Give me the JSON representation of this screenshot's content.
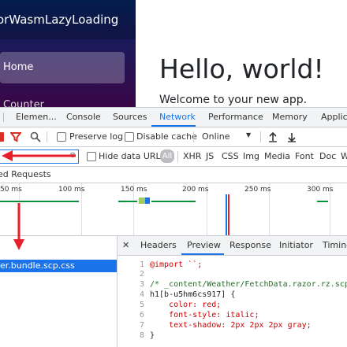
{
  "app": {
    "brand": "orWasmLazyLoading",
    "nav": {
      "home": "Home",
      "counter": "Counter"
    },
    "heading": "Hello, world!",
    "welcome": "Welcome to your new app."
  },
  "devtools": {
    "tabs": [
      "Elemen...",
      "Console",
      "Sources",
      "Network",
      "Performance",
      "Memory",
      "Applica"
    ],
    "active_tab": "Network",
    "toolbar": {
      "preserve_log": "Preserve log",
      "disable_cache": "Disable cache",
      "throttle": "Online"
    },
    "filter": {
      "hide_data_urls": "Hide data URLs",
      "types": [
        "All",
        "XHR",
        "JS",
        "CSS",
        "Img",
        "Media",
        "Font",
        "Doc",
        "W"
      ],
      "active_type": "All"
    },
    "blocked_requests": "ed Requests",
    "timeline_ticks": [
      "50 ms",
      "100 ms",
      "150 ms",
      "200 ms",
      "250 ms",
      "300 ms"
    ],
    "selected_request": "er.bundle.scp.css",
    "detail_tabs": [
      "Headers",
      "Preview",
      "Response",
      "Initiator",
      "Timing"
    ],
    "active_detail_tab": "Preview",
    "code_lines": [
      {
        "n": "1",
        "t": "@import ``;"
      },
      {
        "n": "2",
        "t": ""
      },
      {
        "n": "3",
        "t": "/* _content/Weather/FetchData.razor.rz.scp"
      },
      {
        "n": "4",
        "t": "h1[b-u5hm6cs917] {"
      },
      {
        "n": "5",
        "t": "    color: red;"
      },
      {
        "n": "6",
        "t": "    font-style: italic;"
      },
      {
        "n": "7",
        "t": "    text-shadow: 2px 2px 2px gray;"
      },
      {
        "n": "8",
        "t": "}"
      }
    ]
  },
  "colors": {
    "accent": "#1a73e8",
    "annotation_red": "#e8202a",
    "sidebar_top": "#052767",
    "sidebar_bottom": "#3a0647"
  }
}
